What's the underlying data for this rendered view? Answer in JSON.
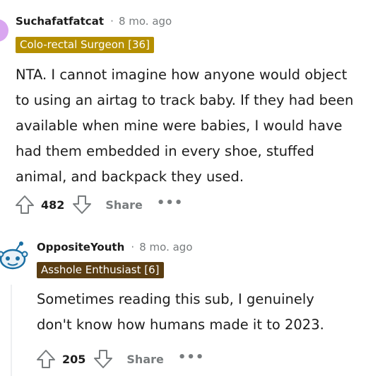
{
  "colors": {
    "flair1_bg": "#b58f00",
    "flair2_bg": "#5a3d12",
    "muted": "#787c7e",
    "text": "#1c1c1c"
  },
  "comments": [
    {
      "username": "Suchafatfatcat",
      "separator": "·",
      "time": "8 mo. ago",
      "flair": "Colo-rectal Surgeon [36]",
      "lines": [
        "NTA. I cannot imagine how anyone would object",
        "to using an airtag to track baby. If they had been",
        "available when mine were babies, I would have",
        "had them embedded in every shoe, stuffed",
        "animal, and backpack they used."
      ],
      "votes": "482",
      "share_label": "Share",
      "more_label": "•••"
    },
    {
      "username": "OppositeYouth",
      "separator": "·",
      "time": "8 mo. ago",
      "flair": "Asshole Enthusiast [6]",
      "lines": [
        "Sometimes reading this sub, I genuinely",
        "don't know how humans made it to 2023."
      ],
      "votes": "205",
      "share_label": "Share",
      "more_label": "•••"
    }
  ]
}
